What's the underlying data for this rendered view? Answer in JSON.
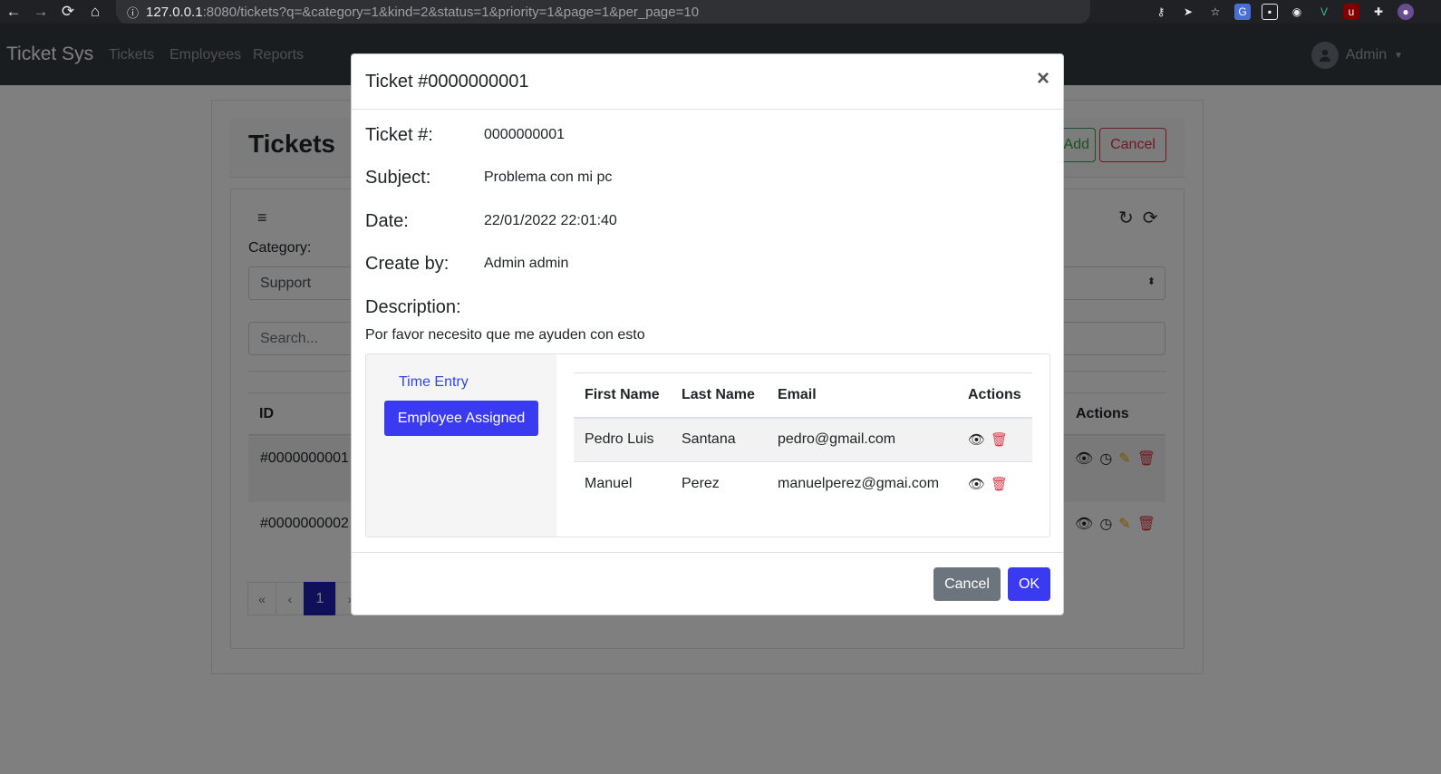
{
  "browser": {
    "back_icon": "back-arrow-icon",
    "forward_icon": "forward-arrow-icon",
    "reload_icon": "reload-icon",
    "home_icon": "home-icon",
    "url_host": "127.0.0.1",
    "url_rest": ":8080/tickets?q=&category=1&kind=2&status=1&priority=1&page=1&per_page=10"
  },
  "navbar": {
    "brand": "Ticket Sys",
    "links": [
      "Tickets",
      "Employees",
      "Reports"
    ],
    "user": "Admin"
  },
  "page": {
    "title": "Tickets",
    "add_label": "Add",
    "cancel_label": "Cancel",
    "category_label": "Category:",
    "category_value": "Support",
    "search_placeholder": "Search...",
    "table": {
      "id_header": "ID",
      "actions_header": "Actions",
      "rows": [
        "#0000000001",
        "#0000000002"
      ]
    },
    "pager": {
      "first": "«",
      "prev": "‹",
      "current": "1",
      "next": "›"
    }
  },
  "modal": {
    "title": "Ticket #0000000001",
    "close": "×",
    "fields": {
      "ticket_label": "Ticket #:",
      "ticket_value": "0000000001",
      "subject_label": "Subject:",
      "subject_value": "Problema con mi pc",
      "date_label": "Date:",
      "date_value": "22/01/2022 22:01:40",
      "creator_label": "Create by:",
      "creator_value": "Admin admin",
      "description_label": "Description:",
      "description_value": "Por favor necesito que me ayuden con esto"
    },
    "tabs": {
      "time_entry": "Time Entry",
      "employee_assigned": "Employee Assigned"
    },
    "employees": {
      "headers": [
        "First Name",
        "Last Name",
        "Email",
        "Actions"
      ],
      "rows": [
        {
          "first": "Pedro Luis",
          "last": "Santana",
          "email": "pedro@gmail.com"
        },
        {
          "first": "Manuel",
          "last": "Perez",
          "email": "manuelperez@gmai.com"
        }
      ]
    },
    "cancel_label": "Cancel",
    "ok_label": "OK"
  },
  "colors": {
    "primary": "#3a3af0",
    "danger": "#dc3545",
    "success": "#28a745",
    "secondary": "#6c757d",
    "navbar": "#343a40"
  }
}
